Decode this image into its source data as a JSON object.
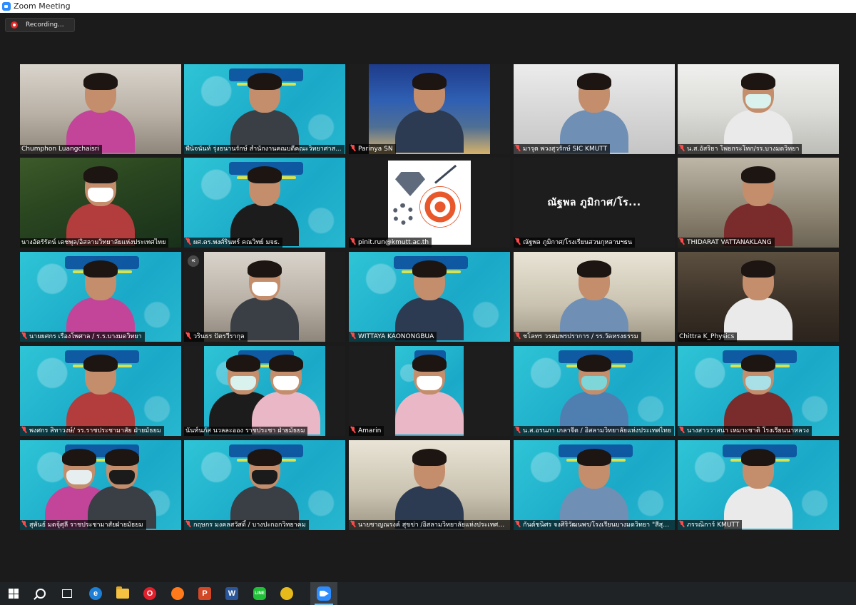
{
  "window": {
    "title": "Zoom Meeting"
  },
  "recording": {
    "label": "Recording..."
  },
  "colors": {
    "accent": "#2d8cff",
    "active_speaker_border": "#e4e15a",
    "muted_icon": "#ff4a4a",
    "recording_dot": "#e02828"
  },
  "participants": [
    {
      "name": "Chumphon Luangchaisri",
      "muted": false,
      "scene": "room"
    },
    {
      "name": "พีนิจนันท์ รุ่งธนานรักษ์ สำนักงานคณบดีคณะวิทยาศาส...",
      "muted": false,
      "scene": "banner",
      "active_speaker": true
    },
    {
      "name": "Parinya SN",
      "muted": true,
      "scene": "night"
    },
    {
      "name": "มารุต พวงสุวรักษ์ SIC KMUTT",
      "muted": true,
      "scene": "office"
    },
    {
      "name": "น.ส.อัสริยา โพยกระโทก/รร.บางมดวิทยา",
      "muted": true,
      "scene": "cabinet"
    },
    {
      "name": "นางอัตรัรัตน์ เดชพุล/อิสลามวิทยาลัยแห่งประเทศไทย",
      "muted": false,
      "scene": "forest"
    },
    {
      "name": "ผศ.ดร.พงศ์รินทร์ คณวิทย์ มจธ.",
      "muted": true,
      "scene": "banner"
    },
    {
      "name": "pinit.run@kmutt.ac.th",
      "muted": true,
      "scene": "logo"
    },
    {
      "name": "ณัฐพล ภูมิกาศ/โรงเรียนสวนกุหลาบฯธน",
      "muted": true,
      "scene": "name-only",
      "display_text": "ณัฐพล ภูมิกาศ/โร..."
    },
    {
      "name": "THIDARAT VATTANAKLANG",
      "muted": true,
      "scene": "lab"
    },
    {
      "name": "นายยศกร เรืองโพศาล / ร.ร.บางมดวิทยา",
      "muted": true,
      "scene": "banner"
    },
    {
      "name": "วรินธร ปัตรวีรากุล",
      "muted": true,
      "scene": "room",
      "collapse_label": "«"
    },
    {
      "name": "WITTAYA KAONONGBUA",
      "muted": true,
      "scene": "banner"
    },
    {
      "name": "ชโลทร วรสมพรปราการ / รร.วัดหรงธรรม",
      "muted": true,
      "scene": "shelf"
    },
    {
      "name": "Chittra K_Physics",
      "muted": false,
      "scene": "room-dark"
    },
    {
      "name": "พงศกร สิทาวงษ์/ รร.ราชประชามาสัย ฝ่ายมัธยม",
      "muted": true,
      "scene": "banner"
    },
    {
      "name": "นันท์นภัส นวลละออง ราชประชา ฝ่ายมัธยม",
      "muted": false,
      "scene": "banner"
    },
    {
      "name": "Amarin",
      "muted": true,
      "scene": "banner"
    },
    {
      "name": "น.ส.อรนภา เกลาจีต / อิสลามวิทยาลัยแห่งประเทศไทย",
      "muted": true,
      "scene": "banner"
    },
    {
      "name": "นางสาววาสนา เหมาะชาติ โรงเรียนนาหลวง",
      "muted": true,
      "scene": "banner"
    },
    {
      "name": "สุพันธ์ มดจุ้ศุลี ราชประชามาสัยฝ่ายมัธยม",
      "muted": true,
      "scene": "banner"
    },
    {
      "name": "กฤษกร มงคลสวัสดิ์ / บางปะกอกวิทยาคม",
      "muted": true,
      "scene": "banner"
    },
    {
      "name": "นายชาญณรงค์ สุขข่า /อิสลามวิทยาลัยแห่งประเทศไทย",
      "muted": true,
      "scene": "shelf"
    },
    {
      "name": "กันต์ชนิศร จงศิริวัฒนพร/โรงเรียนบางมดวิทยา \"สีสุก...",
      "muted": true,
      "scene": "banner"
    },
    {
      "name": "ภรรณิการ์ KMUTT",
      "muted": true,
      "scene": "banner"
    }
  ],
  "taskbar": {
    "items": [
      {
        "name": "start",
        "icon": "windows-logo-icon"
      },
      {
        "name": "search",
        "icon": "search-icon"
      },
      {
        "name": "task-view",
        "icon": "task-view-icon"
      },
      {
        "name": "edge",
        "icon": "edge-icon",
        "color": "#1f7fd4",
        "glyph": "e"
      },
      {
        "name": "file-explorer",
        "icon": "folder-icon"
      },
      {
        "name": "opera",
        "icon": "opera-icon",
        "color": "#e0202b",
        "glyph": "O"
      },
      {
        "name": "firefox",
        "icon": "firefox-icon",
        "color": "#ff7a1a",
        "glyph": ""
      },
      {
        "name": "powerpoint",
        "icon": "powerpoint-icon",
        "color": "#d24726",
        "glyph": "P"
      },
      {
        "name": "word",
        "icon": "word-icon",
        "color": "#2b579a",
        "glyph": "W"
      },
      {
        "name": "line",
        "icon": "line-icon",
        "color": "#21c039",
        "glyph": "LINE"
      },
      {
        "name": "chrome",
        "icon": "chrome-icon",
        "color": "#e7ba1c",
        "glyph": ""
      },
      {
        "name": "zoom",
        "icon": "zoom-icon",
        "active": true
      }
    ]
  }
}
